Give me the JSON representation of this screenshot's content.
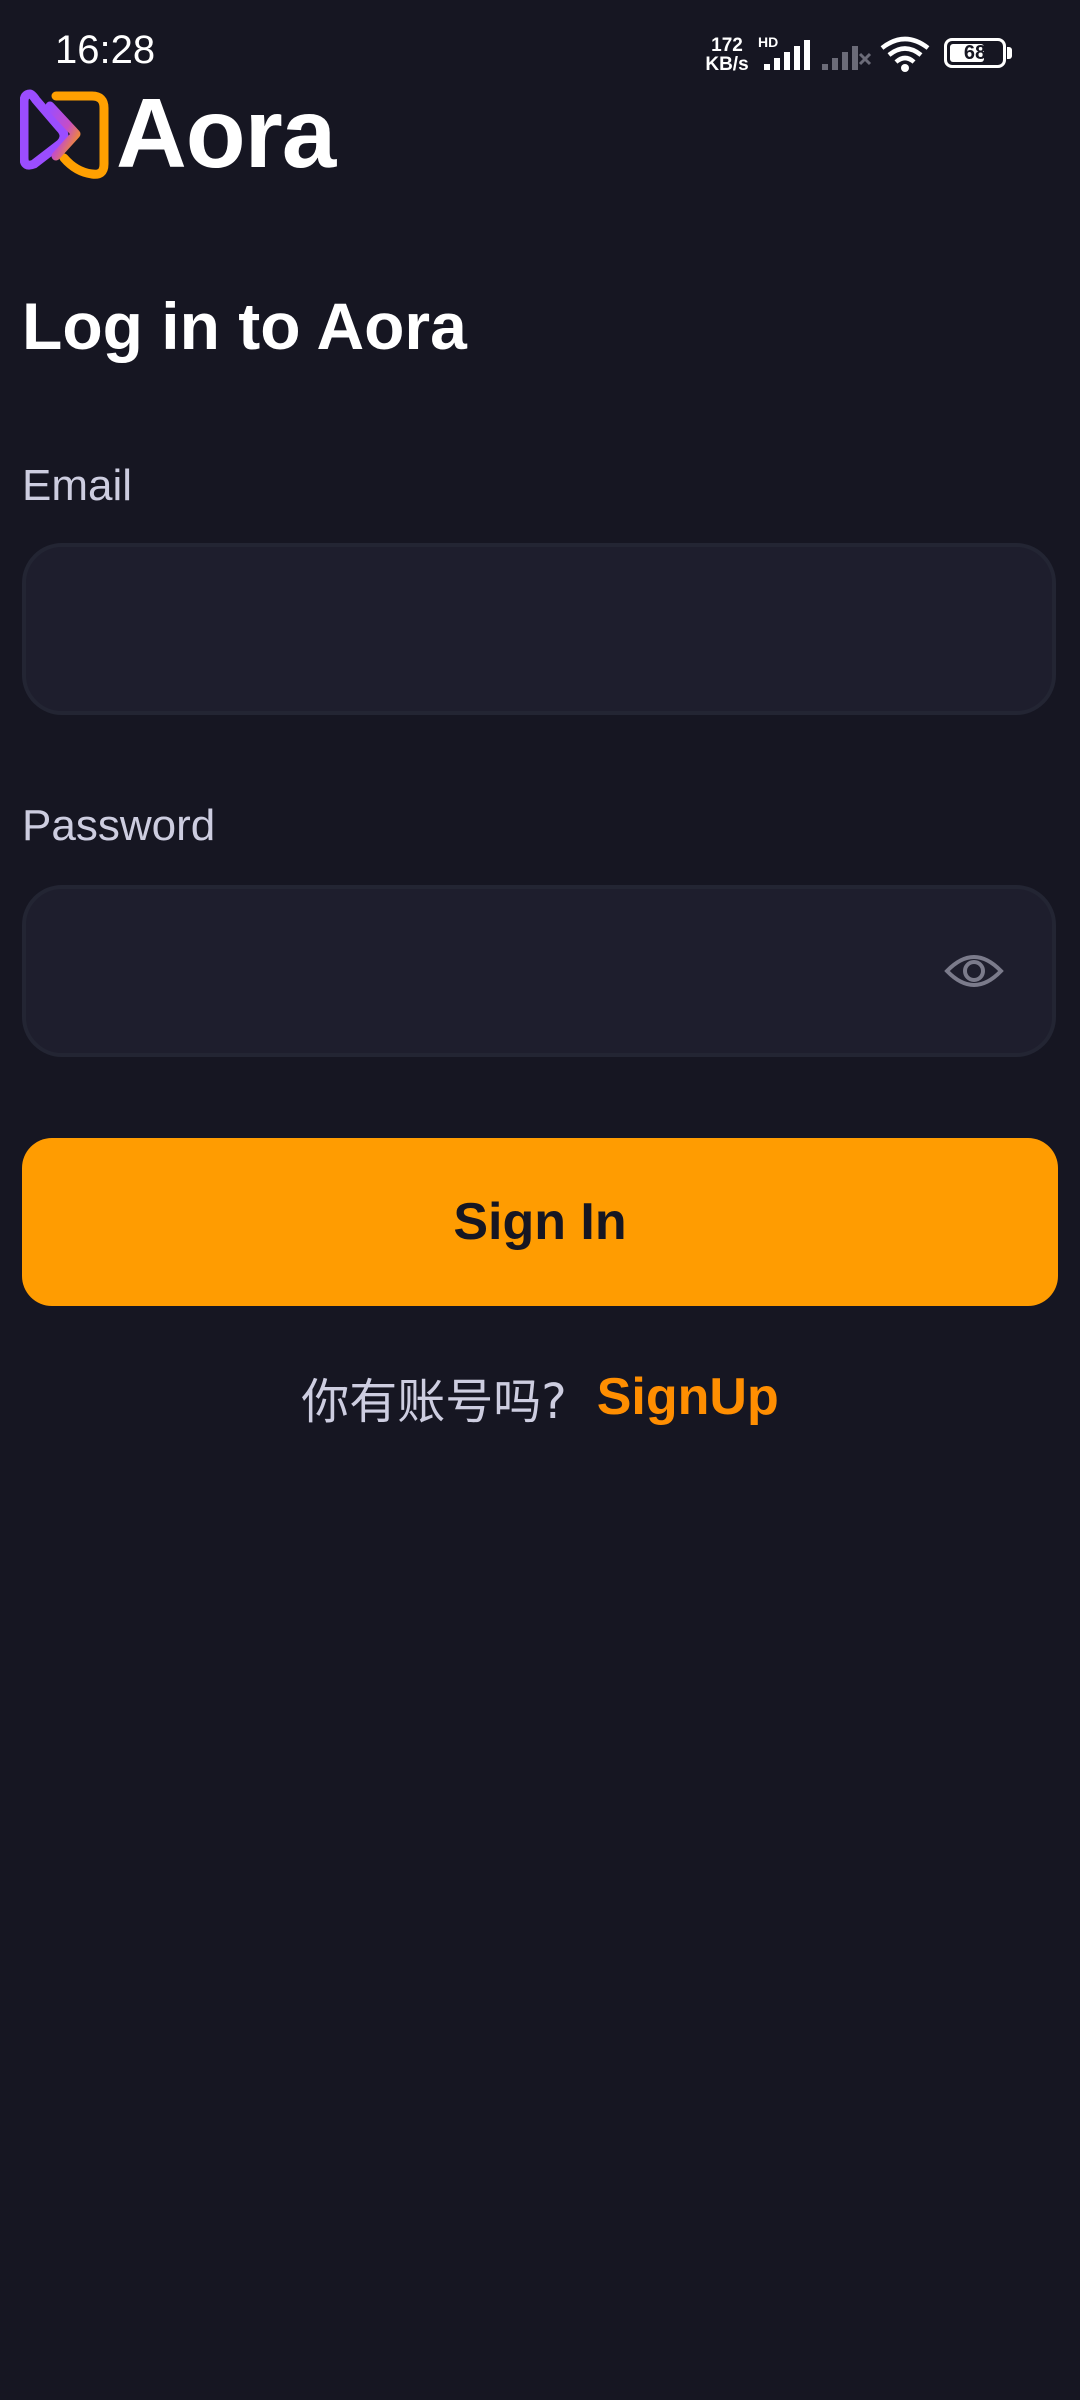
{
  "status_bar": {
    "time": "16:28",
    "net_speed_value": "172",
    "net_speed_unit": "KB/s",
    "network_type": "HD",
    "battery_level": "68",
    "icons": [
      "signal-icon",
      "signal-no-service-icon",
      "wifi-icon",
      "battery-icon"
    ]
  },
  "brand": {
    "name": "Aora",
    "logo_icon": "aora-logo-icon",
    "colors": {
      "purple": "#9b4dff",
      "orange": "#ffa001"
    }
  },
  "form": {
    "title": "Log in to Aora",
    "email_label": "Email",
    "email_value": "",
    "password_label": "Password",
    "password_value": "",
    "password_toggle_icon": "eye-icon",
    "submit_label": "Sign In"
  },
  "footer": {
    "prompt": "你有账号吗?",
    "link": "SignUp"
  },
  "colors": {
    "background": "#161622",
    "field_background": "#1e1e2d",
    "field_border": "#232533",
    "button": "#ff9c01",
    "link": "#ff8e01",
    "label": "#cdcde0"
  }
}
